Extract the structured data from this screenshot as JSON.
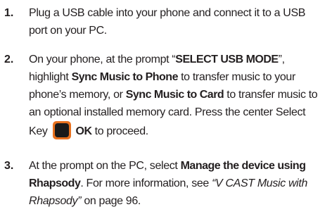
{
  "steps": [
    {
      "number": "1.",
      "lines": [
        {
          "t1": "Plug a USB cable into your phone and connect it to a USB"
        },
        {
          "t1": "port on your PC."
        }
      ]
    },
    {
      "number": "2.",
      "l1a": "On your phone, at the prompt “",
      "l1b": "SELECT USB MODE",
      "l1c": "”,",
      "l2a": "highlight ",
      "l2b": "Sync Music to Phone",
      "l2c": " to transfer music to your",
      "l3a": "phone’s memory, or ",
      "l3b": "Sync Music to Card",
      "l3c": " to transfer music to",
      "l4": "an optional installed memory card. Press the center Select",
      "l5a": "Key",
      "key_icon": "select-key-icon",
      "l5b": "OK",
      "l5c": " to proceed."
    },
    {
      "number": "3.",
      "l1a": "At the prompt on the PC, select ",
      "l1b": "Manage the device using",
      "l2a": "Rhapsody",
      "l2b": ". For more information, see ",
      "l2c": "“V CAST Music with",
      "l3a": "Rhapsody”",
      "l3b": " on page 96."
    }
  ]
}
